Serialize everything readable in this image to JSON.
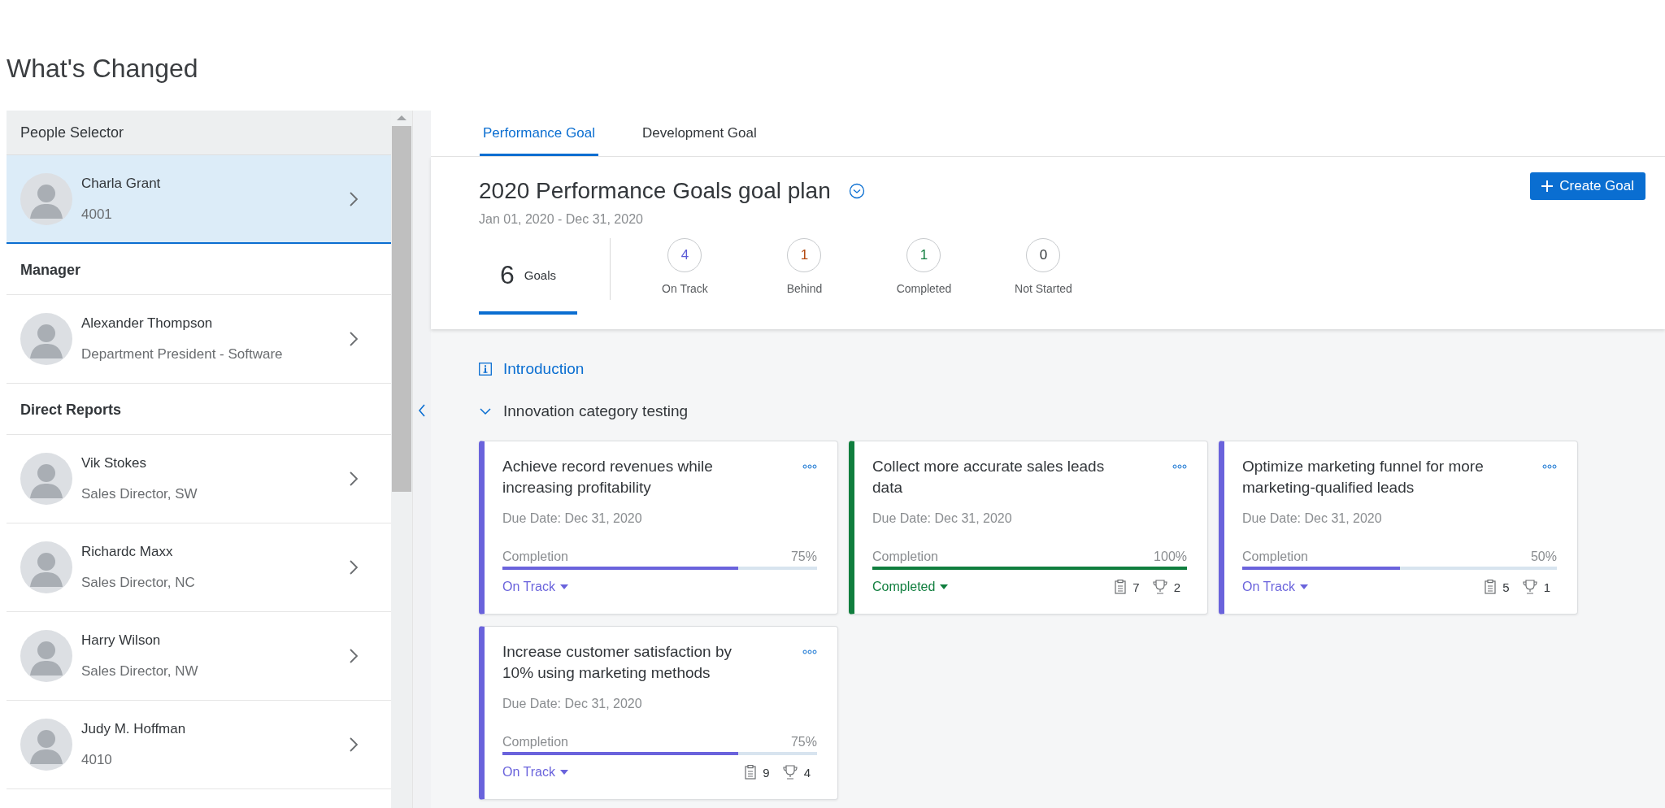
{
  "heading": "What's Changed",
  "people_selector": {
    "title": "People Selector",
    "sections": [
      {
        "people": [
          {
            "name": "Charla Grant",
            "detail": "4001",
            "selected": true
          }
        ]
      },
      {
        "header": "Manager",
        "people": [
          {
            "name": "Alexander Thompson",
            "detail": "Department President - Software",
            "selected": false
          }
        ]
      },
      {
        "header": "Direct Reports",
        "people": [
          {
            "name": "Vik Stokes",
            "detail": "Sales Director, SW",
            "selected": false
          },
          {
            "name": "Richardc Maxx",
            "detail": "Sales Director, NC",
            "selected": false
          },
          {
            "name": "Harry Wilson",
            "detail": "Sales Director, NW",
            "selected": false
          },
          {
            "name": "Judy M. Hoffman",
            "detail": "4010",
            "selected": false
          }
        ]
      }
    ]
  },
  "tabs": [
    {
      "label": "Performance Goal",
      "selected": true
    },
    {
      "label": "Development Goal",
      "selected": false
    }
  ],
  "plan": {
    "title": "2020 Performance Goals goal plan",
    "dates": "Jan 01, 2020 - Dec 31, 2020",
    "create_button": "Create Goal",
    "total": {
      "count": "6",
      "label": "Goals",
      "selected": true
    },
    "stats": [
      {
        "count": "4",
        "label": "On Track",
        "color": "#5b5bd6"
      },
      {
        "count": "1",
        "label": "Behind",
        "color": "#b3480f"
      },
      {
        "count": "1",
        "label": "Completed",
        "color": "#107e3e"
      },
      {
        "count": "0",
        "label": "Not Started",
        "color": "#32363a"
      }
    ]
  },
  "introduction": "Introduction",
  "category": {
    "title": "Innovation category testing",
    "expanded": true
  },
  "goals": [
    {
      "title": "Achieve record revenues while increasing profitability",
      "due": "Due Date: Dec 31, 2020",
      "completion_label": "Completion",
      "percent": "75%",
      "level": 0.75,
      "status": "On Track",
      "color": "#6a63dc"
    },
    {
      "title": "Collect more accurate sales leads data",
      "due": "Due Date: Dec 31, 2020",
      "completion_label": "Completion",
      "percent": "100%",
      "level": 1,
      "status": "Completed",
      "color": "#107e3e",
      "notes": "7",
      "achievements": "2"
    },
    {
      "title": "Optimize marketing funnel for more marketing-qualified leads",
      "due": "Due Date: Dec 31, 2020",
      "completion_label": "Completion",
      "percent": "50%",
      "level": 0.5,
      "status": "On Track",
      "color": "#6a63dc",
      "notes": "5",
      "achievements": "1"
    },
    {
      "title": "Increase customer satisfaction by 10% using marketing methods",
      "due": "Due Date: Dec 31, 2020",
      "completion_label": "Completion",
      "percent": "75%",
      "level": 0.75,
      "status": "On Track",
      "color": "#6a63dc",
      "notes": "9",
      "achievements": "4"
    }
  ]
}
